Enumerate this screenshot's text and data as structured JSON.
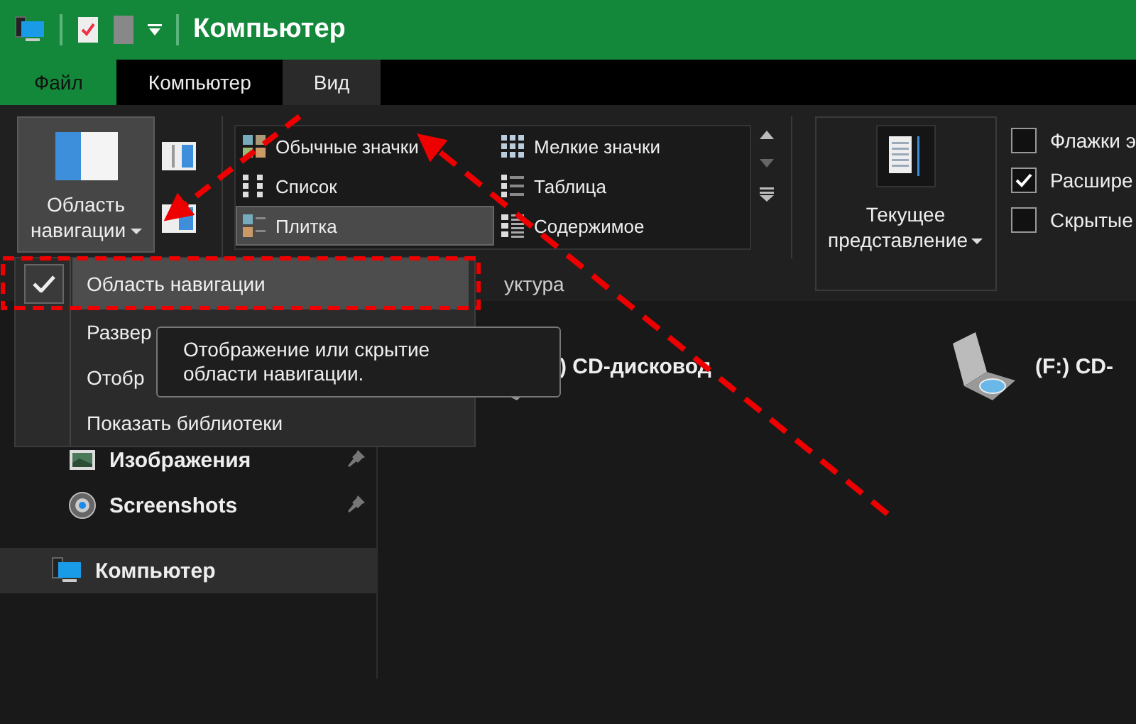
{
  "window": {
    "title": "Компьютер"
  },
  "ribbon_tabs": [
    {
      "label": "Файл",
      "kind": "file",
      "selected": false
    },
    {
      "label": "Компьютер",
      "kind": "tab",
      "selected": false
    },
    {
      "label": "Вид",
      "kind": "tab",
      "selected": true
    }
  ],
  "ribbon": {
    "navigation_pane_button": "Область навигации",
    "layouts": [
      {
        "label": "Обычные значки",
        "kind": "medium",
        "selected": false
      },
      {
        "label": "Мелкие значки",
        "kind": "small",
        "selected": false
      },
      {
        "label": "Список",
        "kind": "list",
        "selected": false
      },
      {
        "label": "Таблица",
        "kind": "details",
        "selected": false
      },
      {
        "label": "Плитка",
        "kind": "tiles",
        "selected": true
      },
      {
        "label": "Содержимое",
        "kind": "content",
        "selected": false
      }
    ],
    "current_view": "Текущее представление",
    "checkboxes": [
      {
        "label": "Флажки э",
        "checked": false
      },
      {
        "label": "Расшире",
        "checked": true
      },
      {
        "label": "Скрытые",
        "checked": false
      }
    ],
    "group_label": "уктура"
  },
  "navigation": [
    {
      "label": "Изображения",
      "kind": "pictures",
      "pinned": true,
      "selected": false
    },
    {
      "label": "Screenshots",
      "kind": "screenshots",
      "pinned": true,
      "selected": false
    },
    {
      "label": "Компьютер",
      "kind": "computer",
      "pinned": false,
      "selected": true
    }
  ],
  "drives": [
    {
      "label": ") CD-дисковод"
    },
    {
      "label": "(F:) CD-"
    }
  ],
  "dropdown": {
    "items": [
      {
        "label": "Область навигации",
        "checked": true,
        "highlighted": true
      },
      {
        "label": "Развер",
        "checked": false,
        "highlighted": false
      },
      {
        "label": "Отобр",
        "checked": false,
        "highlighted": false
      },
      {
        "label": "Показать библиотеки",
        "checked": false,
        "highlighted": false
      }
    ]
  },
  "tooltip": "Отображение или скрытие области навигации."
}
